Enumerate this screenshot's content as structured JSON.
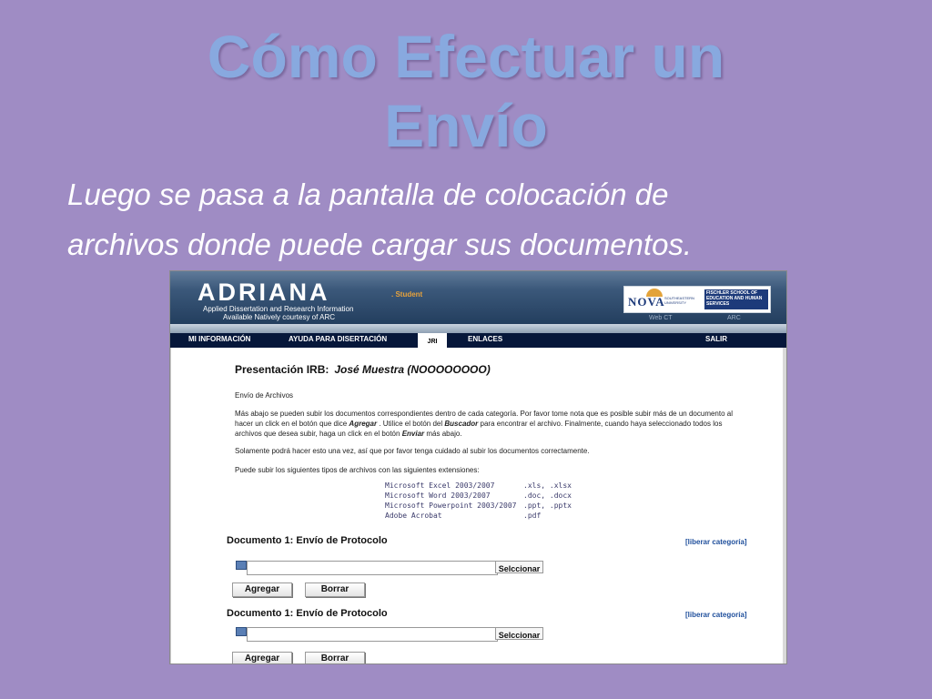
{
  "slide": {
    "title_line1": "Cómo Efectuar un",
    "title_line2": "Envío",
    "subtitle_line1": "Luego se pasa a la pantalla de colocación de",
    "subtitle_line2": "archivos donde puede cargar sus documentos."
  },
  "banner": {
    "logo": "ADRIANA",
    "logo_sub": ". Student",
    "line1": "Applied Dissertation and Research Information",
    "line2": "Available Natively courtesy of ARC",
    "nova": "NOVA",
    "nova_univ": "SOUTHEASTERN UNIVERSITY",
    "fischler": "FISCHLER SCHOOL OF EDUCATION AND HUMAN SERVICES",
    "link_webct": "Web CT",
    "link_arc": "ARC"
  },
  "nav": {
    "mi_informacion": "MI INFORMACIÓN",
    "ayuda": "AYUDA PARA DISERTACIÓN",
    "jri": "JRI",
    "enlaces": "ENLACES",
    "salir": "SALIR"
  },
  "content": {
    "irb_label": "Presentación IRB:",
    "irb_name": "José Muestra (NOOOOOOOO)",
    "section": "Envío de Archivos",
    "p1_a": "Más abajo se pueden subir los documentos correspondientes dentro de cada categoría. Por favor tome nota que es posible subir más de un documento al hacer un click en el botón que dice ",
    "p1_agregar": "Agregar",
    "p1_b": " . Utilice el botón del ",
    "p1_buscador": "Buscador",
    "p1_c": " para encontrar el archivo. Finalmente, cuando haya seleccionado todos los archivos que desea subir, haga un click en el botón ",
    "p1_enviar": "Enviar",
    "p1_d": "   más abajo.",
    "p2": "Solamente podrá hacer esto una vez, así que por favor tenga cuidado al subir los documentos correctamente.",
    "p3": "Puede subir los siguientes tipos de archivos con las siguientes extensiones:",
    "file_types": [
      {
        "app": "Microsoft Excel 2003/2007",
        "ext": ".xls, .xlsx"
      },
      {
        "app": "Microsoft Word 2003/2007",
        "ext": ".doc, .docx"
      },
      {
        "app": "Microsoft Powerpoint 2003/2007",
        "ext": ".ppt, .pptx"
      },
      {
        "app": "Adobe Acrobat",
        "ext": ".pdf"
      }
    ]
  },
  "documents": [
    {
      "title": "Documento 1: Envío de Protocolo",
      "liberar": "[liberar categoría]",
      "select": "Selccionar",
      "add": "Agregar",
      "delete": "Borrar",
      "file_value": ""
    },
    {
      "title": "Documento 1: Envío de Protocolo",
      "liberar": "[liberar categoría]",
      "select": "Selccionar",
      "add": "Agregar",
      "delete": "Borrar",
      "file_value": ""
    }
  ],
  "colors": {
    "background": "#9f8cc4",
    "title": "#88a9df",
    "nav": "#06173a"
  },
  "icons": {
    "file_icon": "file-icon"
  }
}
